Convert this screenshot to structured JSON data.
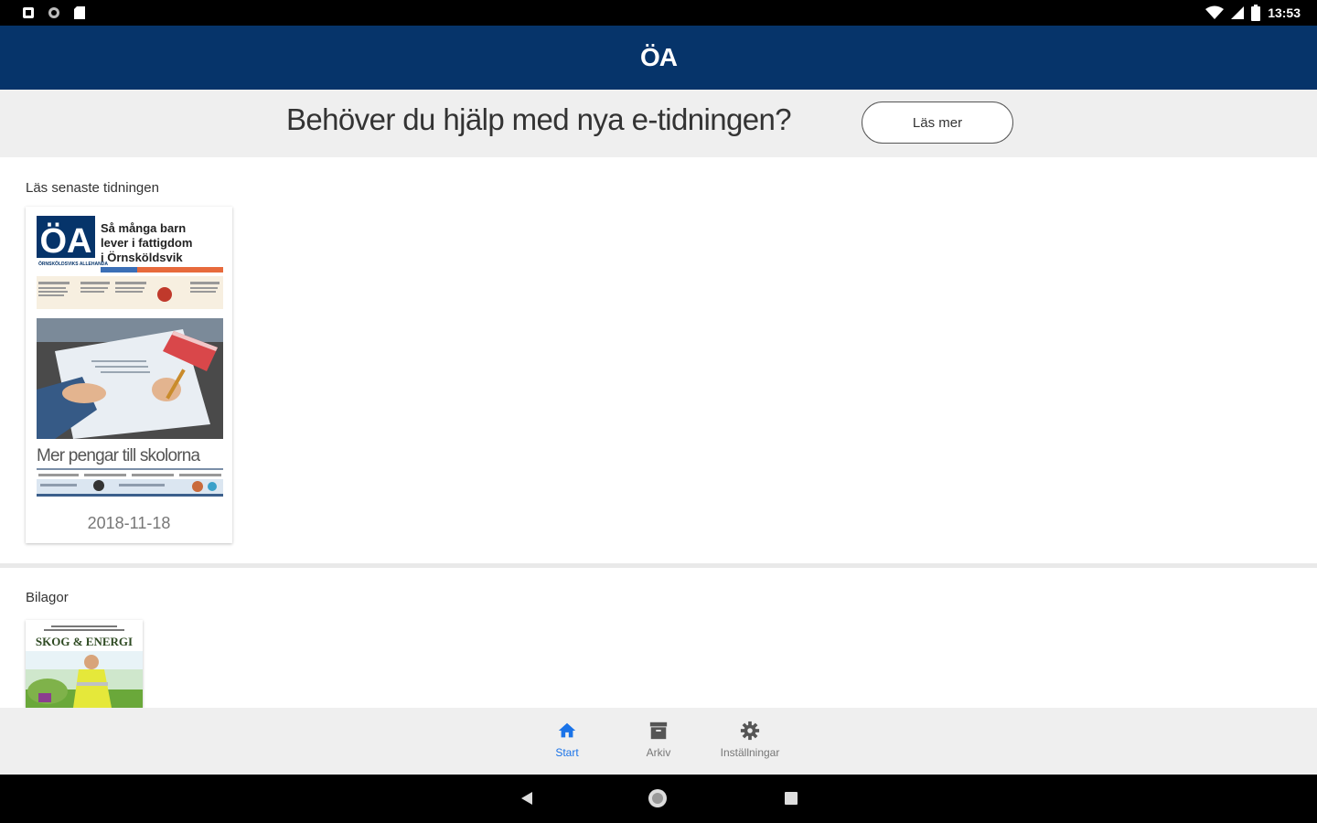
{
  "status_bar": {
    "time": "13:53",
    "left_icons": [
      "notification-icon",
      "circle-icon",
      "sd-card-icon"
    ],
    "right_icons": [
      "wifi-icon",
      "signal-icon",
      "battery-icon"
    ]
  },
  "app_bar": {
    "logo": "ÖA"
  },
  "banner": {
    "text": "Behöver du hjälp med nya e-tidningen?",
    "button_label": "Läs mer"
  },
  "latest": {
    "section_label": "Läs senaste tidningen",
    "cover": {
      "logo": "ÖA",
      "paper_name": "ÖRNSKÖLDSVIKS ALLEHANDA",
      "headline_lines": [
        "Så många barn",
        "lever i fattigdom",
        "i Örnsköldsvik"
      ],
      "main_headline": "Mer pengar till skolorna"
    },
    "date": "2018-11-18"
  },
  "supplements": {
    "section_label": "Bilagor",
    "items": [
      {
        "title": "SKOG & ENERGI"
      }
    ]
  },
  "bottom_nav": {
    "items": [
      {
        "label": "Start",
        "icon": "home-icon",
        "active": true
      },
      {
        "label": "Arkiv",
        "icon": "archive-icon",
        "active": false
      },
      {
        "label": "Inställningar",
        "icon": "gear-icon",
        "active": false
      }
    ]
  },
  "system_nav": {
    "icons": [
      "back-icon",
      "home-circle-icon",
      "recents-icon"
    ]
  },
  "colors": {
    "brand": "#06346a",
    "accent": "#1a73e8"
  }
}
